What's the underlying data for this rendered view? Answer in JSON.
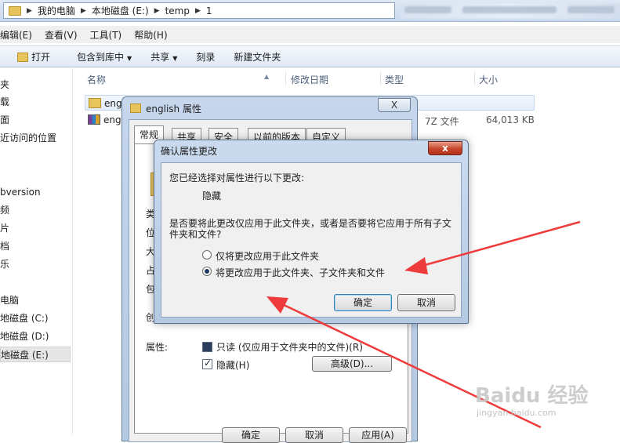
{
  "explorer": {
    "breadcrumb": [
      "我的电脑",
      "本地磁盘 (E:)",
      "temp",
      "1"
    ],
    "menu": [
      "编辑(E)",
      "查看(V)",
      "工具(T)",
      "帮助(H)"
    ],
    "toolbar": {
      "open": "打开",
      "include_in_library": "包含到库中",
      "share": "共享",
      "burn": "刻录",
      "new_folder": "新建文件夹"
    },
    "nav_items": [
      "夹",
      "载",
      "面",
      "近访问的位置",
      "bversion",
      "频",
      "片",
      "档",
      "乐",
      "电脑",
      "地磁盘 (C:)",
      "地磁盘 (D:)",
      "地磁盘 (E:)"
    ],
    "columns": {
      "name": "名称",
      "modified": "修改日期",
      "type": "类型",
      "size": "大小"
    },
    "files": [
      {
        "name": "engl",
        "type": "",
        "size": ""
      },
      {
        "name": "eng",
        "type": "7Z 文件",
        "size": "64,013 KB"
      }
    ]
  },
  "properties": {
    "title": "english 属性",
    "close_label": "X",
    "tabs": [
      "常规",
      "共享",
      "安全",
      "以前的版本",
      "自定义"
    ],
    "labels": [
      "类",
      "位",
      "大",
      "占",
      "包",
      "创",
      "属性:"
    ],
    "readonly_label": "只读 (仅应用于文件夹中的文件)(R)",
    "hidden_label": "隐藏(H)",
    "advanced_button": "高级(D)...",
    "ok_button": "确定",
    "cancel_button": "取消",
    "apply_button": "应用(A)"
  },
  "confirm": {
    "title": "确认属性更改",
    "close_label": "x",
    "intro": "您已经选择对属性进行以下更改:",
    "change": "隐藏",
    "question": "是否要将此更改仅应用于此文件夹，或者是否要将它应用于所有子文件夹和文件?",
    "option_folder_only": "仅将更改应用于此文件夹",
    "option_all": "将更改应用于此文件夹、子文件夹和文件",
    "selected_option": "all",
    "ok_button": "确定",
    "cancel_button": "取消"
  },
  "watermark": {
    "logo": "Baidu 经验",
    "sub": "jingyan.baidu.com"
  },
  "colors": {
    "arrow": "#ee3c3c",
    "title_blue": "#c6d7ec",
    "close_red": "#c7452a"
  }
}
